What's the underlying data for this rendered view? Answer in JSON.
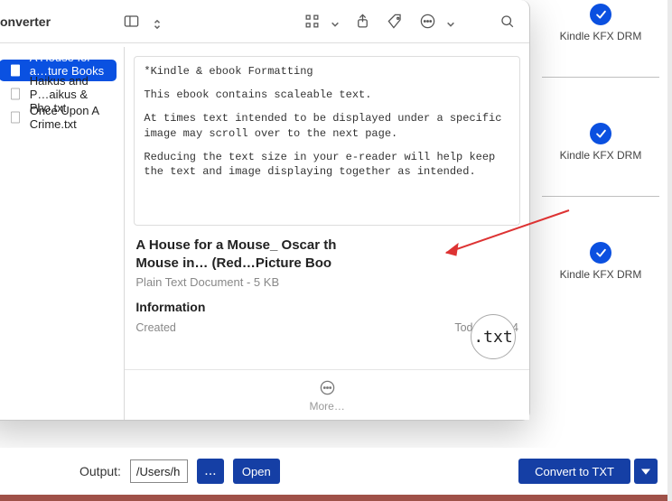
{
  "header": {
    "title": "onverter"
  },
  "right_badges": [
    {
      "label": "Kindle KFX DRM"
    },
    {
      "label": "Kindle KFX DRM"
    },
    {
      "label": "Kindle KFX DRM"
    }
  ],
  "files": [
    {
      "label": "A House for a…ture Books .txt",
      "selected": true
    },
    {
      "label": "Haikus and P…aikus & Pho.txt",
      "selected": false
    },
    {
      "label": "Once Upon A Crime.txt",
      "selected": false
    }
  ],
  "preview": {
    "line1": "*Kindle & ebook Formatting",
    "line2": "This ebook contains scaleable text.",
    "line3": "At times text intended to be displayed under a specific image may scroll over to the next page.",
    "line4": "Reducing the text size in your e-reader will help keep the text and image displaying together as intended.",
    "title_a": "A House for a Mouse_ Oscar th",
    "title_b": "Mouse in… (Red…Picture Boo",
    "sub": "Plain Text Document - 5 KB",
    "info_heading": "Information",
    "created_label": "Created",
    "created_value": "Today, 20:54",
    "ext": ".txt",
    "more_label": "More…"
  },
  "footer": {
    "output_label": "Output:",
    "output_path": "/Users/h",
    "browse_label": "...",
    "open_label": "Open",
    "convert_label": "Convert to TXT"
  }
}
